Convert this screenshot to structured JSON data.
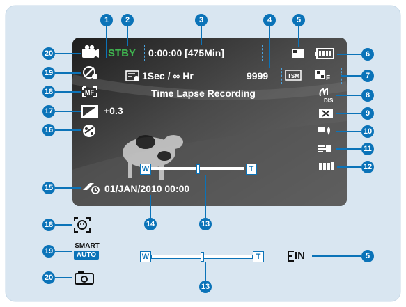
{
  "colors": {
    "panel_bg": "#d9e6f1",
    "screen_bg": "#2a2a2a",
    "stby_green": "#3fb34f",
    "badge_blue": "#0b73b8",
    "text_white": "#ffffff",
    "dark_text": "#111111"
  },
  "status": {
    "stby": "STBY",
    "timecode": "0:00:00 [475Min]"
  },
  "interval": {
    "text": "1Sec / ∞ Hr"
  },
  "counter": "9999",
  "lapse_label": "Time Lapse Recording",
  "exposure": "+0.3",
  "datetime": "01/JAN/2010 00:00",
  "zoom": {
    "w_label": "W",
    "t_label": "T",
    "level": 0.5
  },
  "legend_zoom": {
    "w_label": "W",
    "t_label": "T",
    "level": 0.5
  },
  "smart_auto": {
    "line1": "SMART",
    "line2": "AUTO"
  },
  "sd_label": "IN",
  "badges": {
    "b1": "1",
    "b2": "2",
    "b3": "3",
    "b4": "4",
    "b5": "5",
    "b6": "6",
    "b7": "7",
    "b8": "8",
    "b9": "9",
    "b10": "10",
    "b11": "11",
    "b12": "12",
    "b13": "13",
    "b14": "14",
    "b15": "15",
    "b16": "16",
    "b17": "17",
    "b18": "18",
    "b19": "19",
    "b20": "20"
  },
  "icons": [
    "camcorder-icon",
    "anti-shake-icon",
    "manual-focus-icon",
    "exposure-icon",
    "effect-icon",
    "timer-icon",
    "card-icon",
    "battery-icon",
    "quality-icon",
    "resolution-icon",
    "dis-icon",
    "backlight-icon",
    "white-balance-icon",
    "wind-cut-icon",
    "mic-level-icon",
    "face-detect-icon",
    "smart-auto-icon",
    "photo-icon",
    "built-in-memory-icon"
  ]
}
